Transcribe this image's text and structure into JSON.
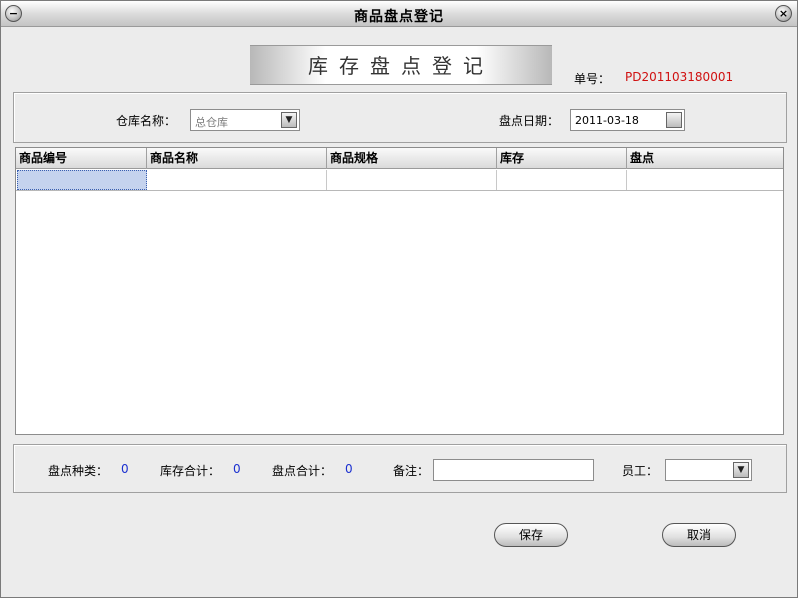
{
  "window": {
    "title": "商品盘点登记"
  },
  "header": {
    "banner": "库存盘点登记",
    "order_label": "单号：",
    "order_no": "PD201103180001"
  },
  "filter": {
    "warehouse_label": "仓库名称：",
    "warehouse_value": "总仓库",
    "date_label": "盘点日期：",
    "date_value": "2011-03-18"
  },
  "table": {
    "columns": [
      "商品编号",
      "商品名称",
      "商品规格",
      "库存",
      "盘点"
    ],
    "rows": [
      [
        "",
        "",
        "",
        "",
        ""
      ]
    ]
  },
  "summary": {
    "kinds_label": "盘点种类：",
    "kinds_value": "0",
    "stock_total_label": "库存合计：",
    "stock_total_value": "0",
    "count_total_label": "盘点合计：",
    "count_total_value": "0",
    "note_label": "备注：",
    "note_value": "",
    "staff_label": "员工：",
    "staff_value": ""
  },
  "actions": {
    "save_label": "保存",
    "cancel_label": "取消"
  },
  "icons": {
    "menu": "circle-minus-icon",
    "close": "close-icon",
    "dropdown": "chevron-down-icon",
    "calendar": "calendar-button-icon"
  }
}
